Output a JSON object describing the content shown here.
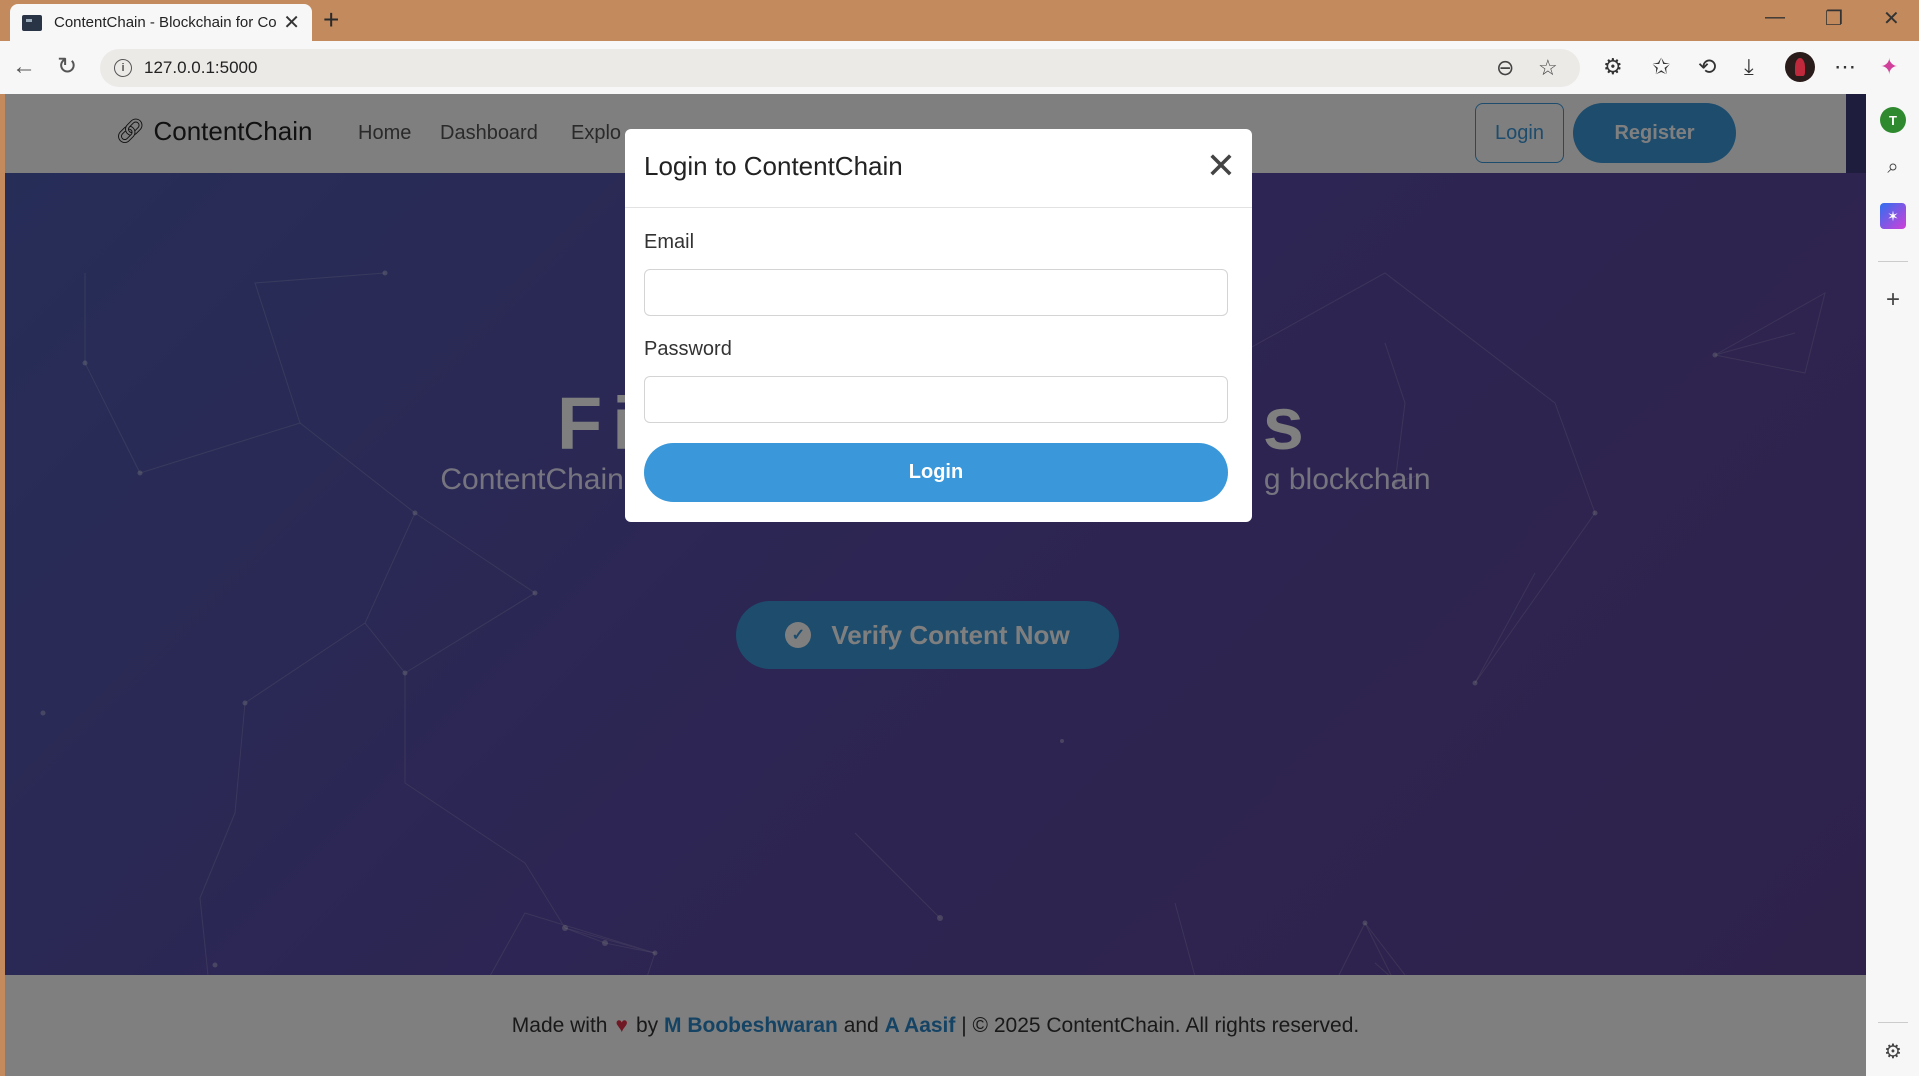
{
  "browser": {
    "tab_title": "ContentChain - Blockchain for Co",
    "url": "127.0.0.1:5000",
    "profile_initial": "T"
  },
  "header": {
    "brand": "ContentChain",
    "nav": [
      "Home",
      "Dashboard",
      "Explo"
    ],
    "login_label": "Login",
    "register_label": "Register"
  },
  "hero": {
    "title_start": "Fi",
    "title_end": "s",
    "subtitle_start": "ContentChain",
    "subtitle_end": "g blockchain",
    "verify_label": "Verify Content Now"
  },
  "modal": {
    "title": "Login to ContentChain",
    "email_label": "Email",
    "email_value": "",
    "password_label": "Password",
    "password_value": "",
    "submit_label": "Login"
  },
  "footer": {
    "made_with": "Made with",
    "by": "by",
    "author1": "M Boobeshwaran",
    "and": "and",
    "author2": "A Aasif",
    "rights": "| © 2025 ContentChain. All rights reserved."
  },
  "colors": {
    "accent": "#3a98da",
    "hero_gradient_start": "#4d5cb0",
    "hero_gradient_end": "#5d4596",
    "heart": "#e0334a"
  }
}
